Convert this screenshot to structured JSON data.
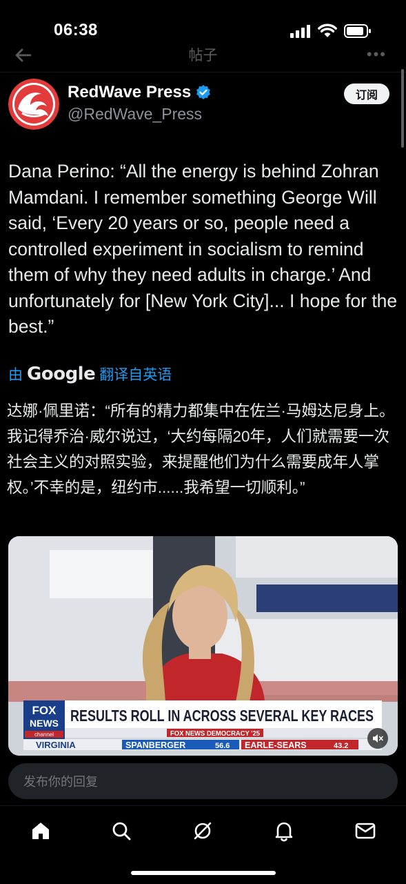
{
  "status_bar": {
    "time": "06:38"
  },
  "nav": {
    "title": "帖子",
    "more": "•••"
  },
  "author": {
    "name": "RedWave Press",
    "handle": "@RedWave_Press",
    "follow_label": "订阅",
    "verified": true
  },
  "tweet": {
    "text": "Dana Perino: “All the energy is behind Zohran Mamdani. I remember something George Will said, ‘Every 20 years or so, people need a controlled experiment in socialism to remind them of why they need adults in charge.’ And unfortunately for [New York City]... I hope for the best.”"
  },
  "translation": {
    "prefix": "由",
    "provider": "Google",
    "suffix": "翻译自英语",
    "text": "达娜·佩里诺：“所有的精力都集中在佐兰·马姆达尼身上。我记得乔治·威尔说过，‘大约每隔20年，人们就需要一次社会主义的对照实验，来提醒他们为什么需要成年人掌权。’不幸的是，纽约市......我希望一切顺利。”"
  },
  "media": {
    "network_logo_top": "FOX",
    "network_logo_bottom": "NEWS",
    "network_logo_sub": "channel",
    "headline": "RESULTS ROLL IN ACROSS SEVERAL KEY RACES",
    "sub_banner": "FOX NEWS DEMOCRACY '25",
    "state": "VIRGINIA",
    "candidate_1": "SPANBERGER",
    "candidate_1_pct": "56.6",
    "candidate_2": "EARLE-SEARS",
    "candidate_2_pct": "43.2",
    "muted_icon": "speaker-mute-icon"
  },
  "reply": {
    "placeholder": "发布你的回复"
  },
  "tabs": [
    "home-icon",
    "search-icon",
    "grok-icon",
    "notifications-icon",
    "messages-icon"
  ],
  "colors": {
    "accent": "#1d9bf0",
    "background": "#000000",
    "text": "#e7e9ea",
    "secondary_text": "#8b9298"
  }
}
